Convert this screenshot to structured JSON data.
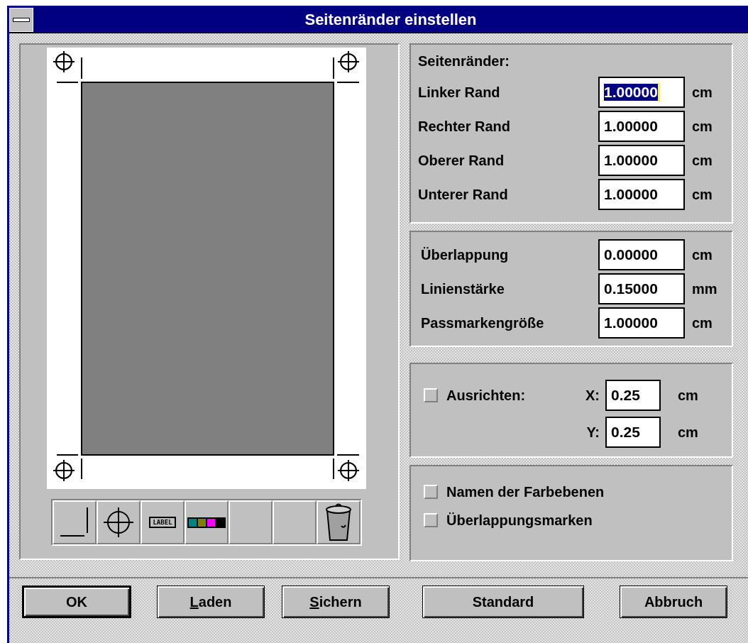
{
  "window": {
    "title": "Seitenränder einstellen"
  },
  "toolbar": [
    {
      "kind": "crop"
    },
    {
      "kind": "target"
    },
    {
      "kind": "label",
      "text": "LABEL"
    },
    {
      "kind": "colors"
    },
    {
      "kind": "empty"
    },
    {
      "kind": "empty"
    },
    {
      "kind": "trash"
    }
  ],
  "margins": {
    "heading": "Seitenränder:",
    "fields": [
      {
        "label": "Linker Rand",
        "value": "1.00000",
        "unit": "cm",
        "selected": true
      },
      {
        "label": "Rechter Rand",
        "value": "1.00000",
        "unit": "cm",
        "selected": false
      },
      {
        "label": "Oberer Rand",
        "value": "1.00000",
        "unit": "cm",
        "selected": false
      },
      {
        "label": "Unterer Rand",
        "value": "1.00000",
        "unit": "cm",
        "selected": false
      }
    ]
  },
  "settings": {
    "fields": [
      {
        "label": "Überlappung",
        "value": "0.00000",
        "unit": "cm"
      },
      {
        "label": "Linienstärke",
        "value": "0.15000",
        "unit": "mm"
      },
      {
        "label": "Passmarkengröße",
        "value": "1.00000",
        "unit": "cm"
      }
    ]
  },
  "align": {
    "label": "Ausrichten:",
    "checked": false,
    "fields": [
      {
        "label": "X:",
        "value": "0.25",
        "unit": "cm"
      },
      {
        "label": "Y:",
        "value": "0.25",
        "unit": "cm"
      }
    ]
  },
  "options": [
    {
      "label": "Namen der Farbebenen",
      "checked": false
    },
    {
      "label": "Überlappungsmarken",
      "checked": false
    }
  ],
  "buttons": [
    {
      "label": "OK",
      "default": true
    },
    {
      "key": "L",
      "label": "aden",
      "default": false
    },
    {
      "key": "S",
      "label": "ichern",
      "default": false
    },
    {
      "label": "Standard",
      "default": false
    },
    {
      "label": "Abbruch",
      "default": false
    }
  ]
}
